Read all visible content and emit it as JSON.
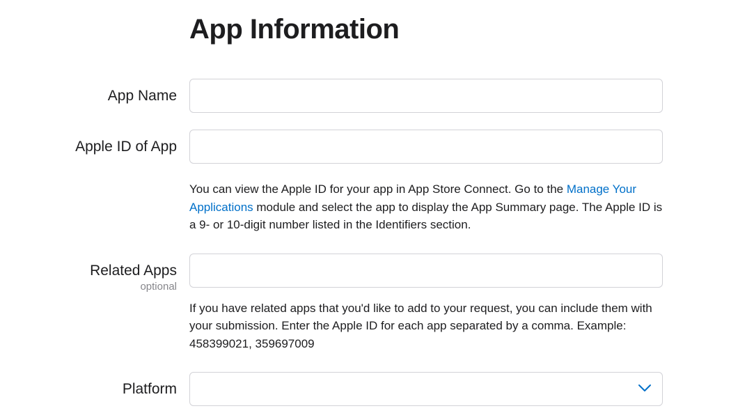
{
  "title": "App Information",
  "fields": {
    "appName": {
      "label": "App Name",
      "value": ""
    },
    "appleId": {
      "label": "Apple ID of App",
      "value": "",
      "help_pre": "You can view the Apple ID for your app in App Store Connect. Go to the ",
      "help_link": "Manage Your Applications",
      "help_post": " module and select the app to display the App Summary page. The Apple ID is a 9- or 10-digit number listed in the Identifiers section."
    },
    "relatedApps": {
      "label": "Related Apps",
      "optional": "optional",
      "value": "",
      "help": "If you have related apps that you'd like to add to your request, you can include them with your submission. Enter the Apple ID for each app separated by a comma. Example: 458399021, 359697009"
    },
    "platform": {
      "label": "Platform",
      "value": ""
    }
  },
  "colors": {
    "link": "#0070c9",
    "border": "#d2d2d7",
    "muted": "#86868b"
  }
}
